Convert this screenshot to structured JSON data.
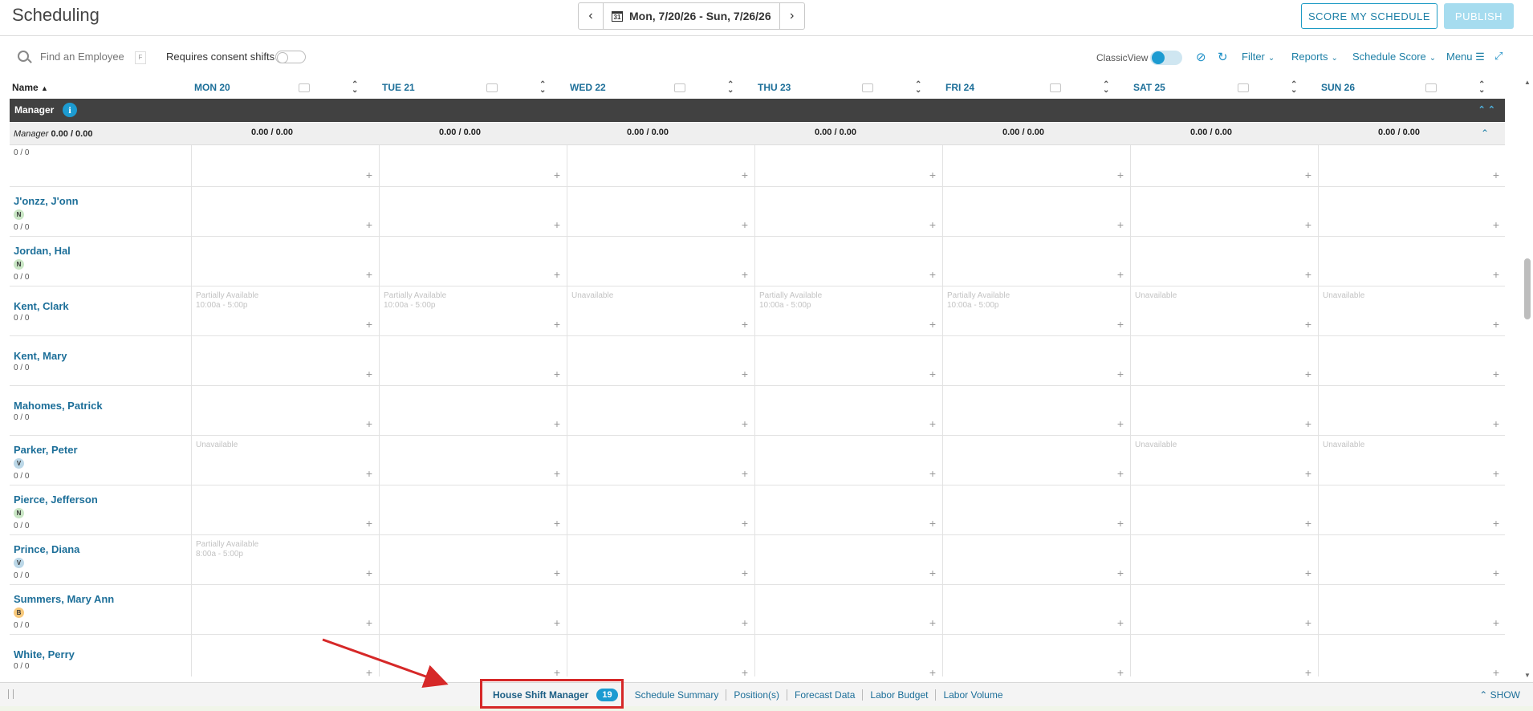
{
  "header": {
    "title": "Scheduling",
    "prev_icon": "chevron-left-icon",
    "next_icon": "chevron-right-icon",
    "calendar_icon_text": "31",
    "date_range": "Mon, 7/20/26 - Sun, 7/26/26",
    "score_button": "SCORE MY SCHEDULE",
    "publish_button": "PUBLISH"
  },
  "toolbar": {
    "search_placeholder": "Find an Employee",
    "search_hint": "F",
    "consent_label": "Requires consent shifts",
    "classic_view_label": "ClassicView",
    "filter_label": "Filter",
    "reports_label": "Reports",
    "score_label": "Schedule Score",
    "menu_label": "Menu"
  },
  "grid": {
    "name_header": "Name",
    "days": [
      "MON 20",
      "TUE 21",
      "WED 22",
      "THU 23",
      "FRI 24",
      "SAT 25",
      "SUN 26"
    ]
  },
  "group": {
    "name": "Manager",
    "summary_label": "Manager",
    "summary_total": "0.00 / 0.00",
    "day_totals": [
      "0.00 / 0.00",
      "0.00 / 0.00",
      "0.00 / 0.00",
      "0.00 / 0.00",
      "0.00 / 0.00",
      "0.00 / 0.00",
      "0.00 / 0.00"
    ]
  },
  "employees": [
    {
      "name": "",
      "badge": "",
      "hours": "0 / 0",
      "avail": [
        "",
        "",
        "",
        "",
        "",
        "",
        ""
      ]
    },
    {
      "name": "J'onzz, J'onn",
      "badge": "N",
      "hours": "0 / 0",
      "avail": [
        "",
        "",
        "",
        "",
        "",
        "",
        ""
      ]
    },
    {
      "name": "Jordan, Hal",
      "badge": "N",
      "hours": "0 / 0",
      "avail": [
        "",
        "",
        "",
        "",
        "",
        "",
        ""
      ]
    },
    {
      "name": "Kent, Clark",
      "badge": "",
      "hours": "0 / 0",
      "avail": [
        "Partially Available\n10:00a - 5:00p",
        "Partially Available\n10:00a - 5:00p",
        "Unavailable",
        "Partially Available\n10:00a - 5:00p",
        "Partially Available\n10:00a - 5:00p",
        "Unavailable",
        "Unavailable"
      ]
    },
    {
      "name": "Kent, Mary",
      "badge": "",
      "hours": "0 / 0",
      "avail": [
        "",
        "",
        "",
        "",
        "",
        "",
        ""
      ]
    },
    {
      "name": "Mahomes, Patrick",
      "badge": "",
      "hours": "0 / 0",
      "avail": [
        "",
        "",
        "",
        "",
        "",
        "",
        ""
      ]
    },
    {
      "name": "Parker, Peter",
      "badge": "V",
      "hours": "0 / 0",
      "avail": [
        "Unavailable",
        "",
        "",
        "",
        "",
        "Unavailable",
        "Unavailable"
      ]
    },
    {
      "name": "Pierce, Jefferson",
      "badge": "N",
      "hours": "0 / 0",
      "avail": [
        "",
        "",
        "",
        "",
        "",
        "",
        ""
      ]
    },
    {
      "name": "Prince, Diana",
      "badge": "V",
      "hours": "0 / 0",
      "avail": [
        "Partially Available\n8:00a - 5:00p",
        "",
        "",
        "",
        "",
        "",
        ""
      ]
    },
    {
      "name": "Summers, Mary Ann",
      "badge": "B",
      "hours": "0 / 0",
      "avail": [
        "",
        "",
        "",
        "",
        "",
        "",
        ""
      ]
    },
    {
      "name": "White, Perry",
      "badge": "",
      "hours": "0 / 0",
      "avail": [
        "",
        "",
        "",
        "",
        "",
        "",
        ""
      ]
    }
  ],
  "bottom": {
    "tabs": [
      {
        "label": "House Shift Manager",
        "count": "19"
      },
      {
        "label": "Schedule Summary"
      },
      {
        "label": "Position(s)"
      },
      {
        "label": "Forecast Data"
      },
      {
        "label": "Labor Budget"
      },
      {
        "label": "Labor Volume"
      }
    ],
    "show_label": "SHOW"
  },
  "colors": {
    "accent": "#1c9bd1",
    "link": "#1d6f99",
    "group_bar": "#414141",
    "annotation": "#d62828"
  }
}
